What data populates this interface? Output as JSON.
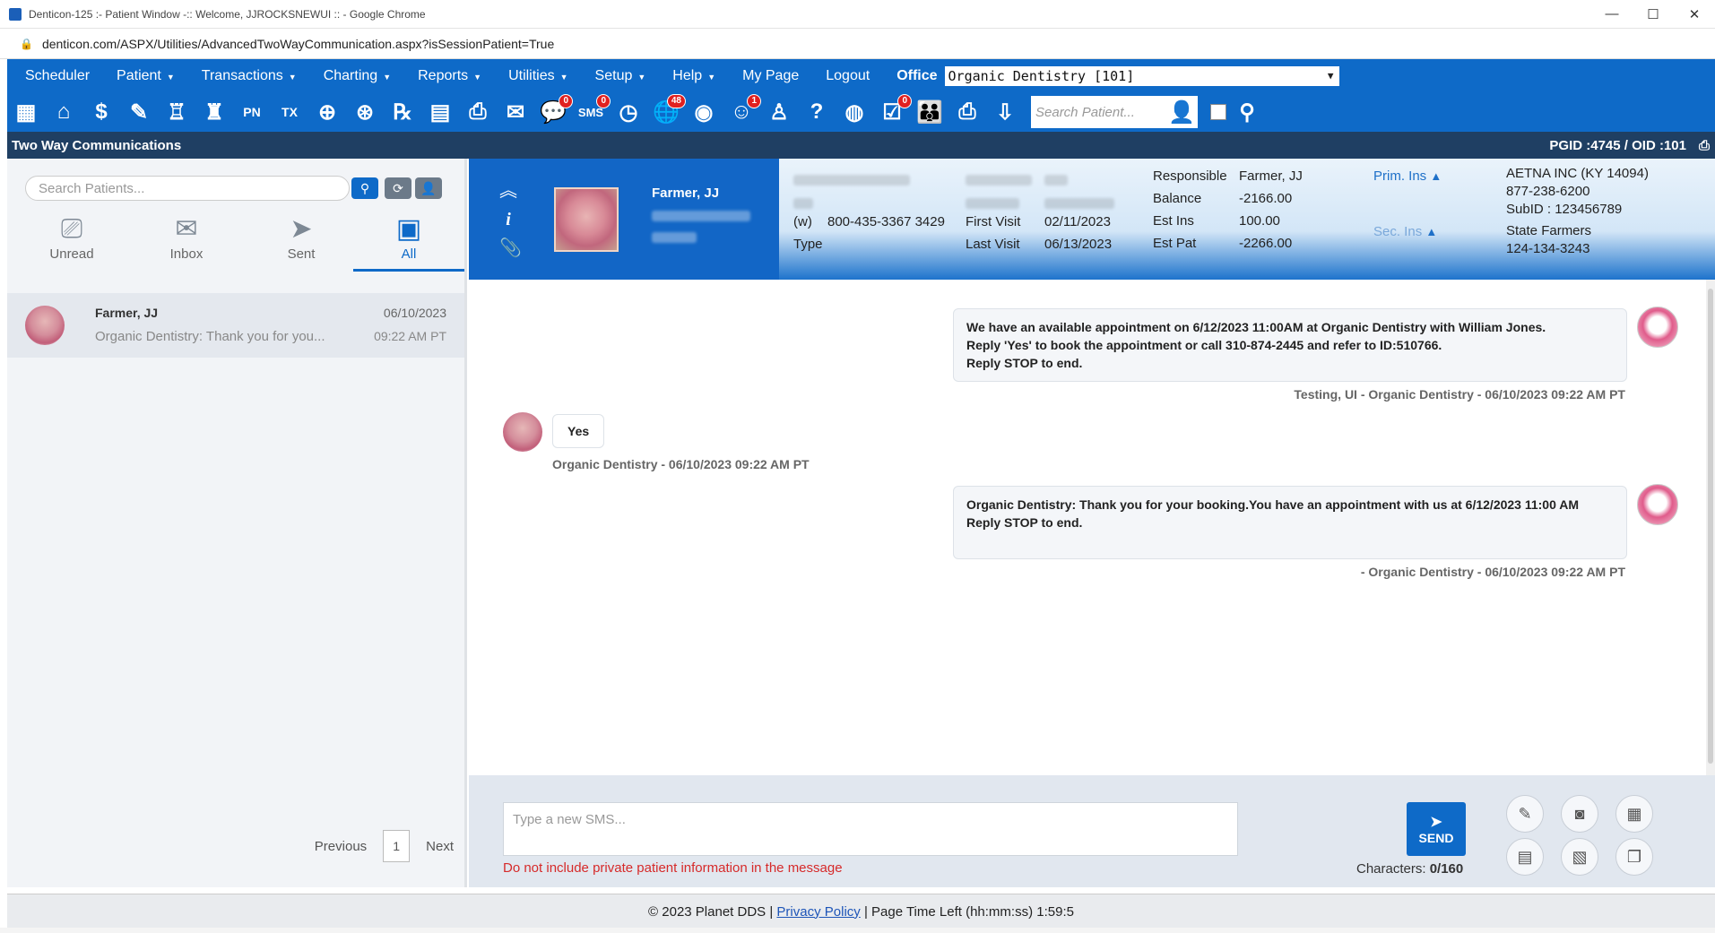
{
  "browser": {
    "title": "Denticon-125 :- Patient Window -:: Welcome, JJROCKSNEWUI :: - Google Chrome",
    "url": "denticon.com/ASPX/Utilities/AdvancedTwoWayCommunication.aspx?isSessionPatient=True"
  },
  "menu": {
    "items": [
      "Scheduler",
      "Patient",
      "Transactions",
      "Charting",
      "Reports",
      "Utilities",
      "Setup",
      "Help",
      "My Page",
      "Logout"
    ],
    "office_label": "Office",
    "office_value": "Organic Dentistry [101]"
  },
  "toolbar": {
    "badges": {
      "messages": "0",
      "sms": "0",
      "web": "48",
      "alerts": "1",
      "forms": "0"
    },
    "search_placeholder": "Search Patient..."
  },
  "section": {
    "title": "Two Way Communications",
    "pgid": "PGID :4745  /  OID :101"
  },
  "left": {
    "search_placeholder": "Search Patients...",
    "tabs": [
      "Unread",
      "Inbox",
      "Sent",
      "All"
    ],
    "active_tab": "All",
    "conversation": {
      "name": "Farmer, JJ",
      "snippet": "Organic Dentistry: Thank you for you...",
      "date": "06/10/2023",
      "time": "09:22 AM PT"
    },
    "pager": {
      "prev": "Previous",
      "page": "1",
      "next": "Next"
    }
  },
  "patient": {
    "name": "Farmer, JJ",
    "phone_label": "(w)",
    "phone": "800-435-3367 3429",
    "type_label": "Type",
    "first_visit_label": "First Visit",
    "first_visit": "02/11/2023",
    "last_visit_label": "Last Visit",
    "last_visit": "06/13/2023",
    "responsible_label": "Responsible",
    "responsible": "Farmer, JJ",
    "balance_label": "Balance",
    "balance": "-2166.00",
    "est_ins_label": "Est Ins",
    "est_ins": "100.00",
    "est_pat_label": "Est Pat",
    "est_pat": "-2266.00",
    "prim_ins_label": "Prim. Ins",
    "prim_ins_name": "AETNA INC (KY 14094)",
    "prim_ins_phone": "877-238-6200",
    "prim_ins_subid": "SubID : 123456789",
    "sec_ins_label": "Sec. Ins",
    "sec_ins_name": "State Farmers",
    "sec_ins_phone": "124-134-3243"
  },
  "chat": {
    "messages": [
      {
        "line1": "We have an available appointment on 6/12/2023 11:00AM at Organic Dentistry with William Jones.",
        "line2": "Reply 'Yes' to book the appointment or call 310-874-2445 and refer to ID:510766.",
        "line3": "Reply STOP to end.",
        "meta": "Testing, UI - Organic Dentistry - 06/10/2023 09:22 AM PT"
      },
      {
        "text": "Yes",
        "meta": "Organic Dentistry - 06/10/2023 09:22 AM PT"
      },
      {
        "line1": "Organic Dentistry: Thank you for your booking.You have an appointment with us at 6/12/2023 11:00 AM",
        "line2": "Reply STOP to end.",
        "meta": "- Organic Dentistry - 06/10/2023 09:22 AM PT"
      }
    ]
  },
  "compose": {
    "placeholder": "Type a new SMS...",
    "send_label": "SEND",
    "warning": "Do not include private patient information in the message",
    "char_label": "Characters:",
    "char_count": "0/160"
  },
  "footer": {
    "copyright": "© 2023 Planet DDS |",
    "privacy": "Privacy Policy",
    "time_left": "| Page Time Left (hh:mm:ss) 1:59:5"
  }
}
